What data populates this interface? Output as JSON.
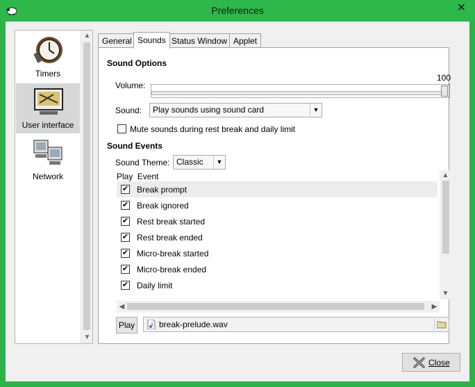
{
  "window": {
    "title": "Preferences",
    "close_glyph": "✕",
    "app_icon": "sheep-icon"
  },
  "sidebar": {
    "items": [
      {
        "label": "Timers",
        "icon": "clock-icon",
        "selected": false
      },
      {
        "label": "User interface",
        "icon": "user-interface-icon",
        "selected": true
      },
      {
        "label": "Network",
        "icon": "network-computers-icon",
        "selected": false
      }
    ]
  },
  "tabs": [
    {
      "label": "General",
      "active": false
    },
    {
      "label": "Sounds",
      "active": true
    },
    {
      "label": "Status Window",
      "active": false
    },
    {
      "label": "Applet",
      "active": false
    }
  ],
  "sound_options": {
    "title": "Sound Options",
    "volume_label": "Volume:",
    "volume_value": "100",
    "volume_level": 1.0,
    "sound_label": "Sound:",
    "sound_selected": "Play sounds using sound card",
    "mute_label": "Mute sounds during rest break and daily limit",
    "mute_checked": false
  },
  "sound_events": {
    "title": "Sound Events",
    "theme_label": "Sound Theme:",
    "theme_selected": "Classic",
    "columns": [
      "Play",
      "Event"
    ],
    "rows": [
      {
        "checked": true,
        "event": "Break prompt"
      },
      {
        "checked": true,
        "event": "Break ignored"
      },
      {
        "checked": true,
        "event": "Rest break started"
      },
      {
        "checked": true,
        "event": "Rest break ended"
      },
      {
        "checked": true,
        "event": "Micro-break started"
      },
      {
        "checked": true,
        "event": "Micro-break ended"
      },
      {
        "checked": true,
        "event": "Daily limit"
      }
    ],
    "play_button": "Play",
    "file_name": "break-prelude.wav"
  },
  "footer": {
    "close_label": "Close"
  },
  "colors": {
    "titlebar": "#2db84a",
    "client_bg": "#f0f0f0",
    "panel_bg": "#ffffff"
  }
}
